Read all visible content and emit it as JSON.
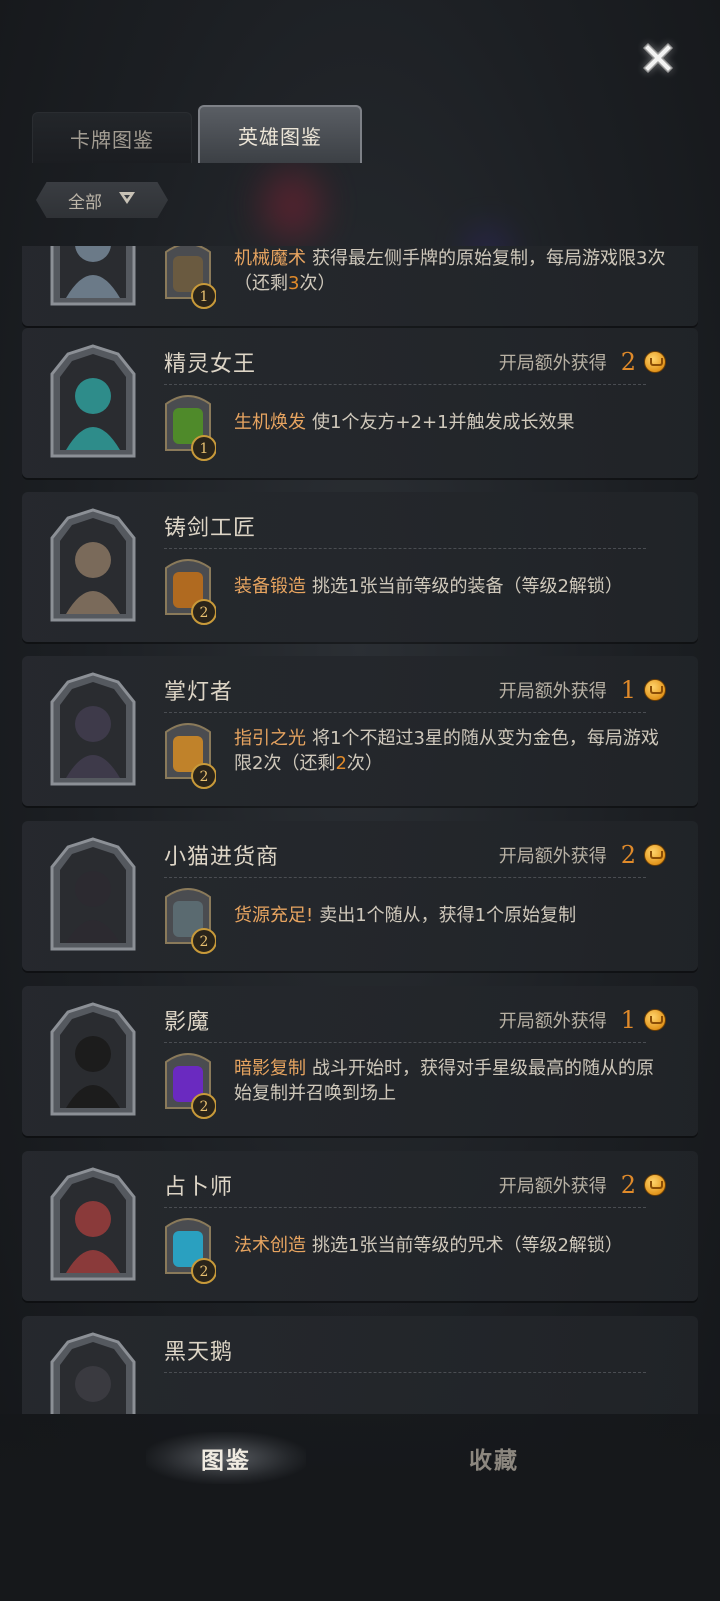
{
  "header": {
    "close_icon": "close-icon",
    "tabs": [
      {
        "label": "卡牌图鉴",
        "active": false
      },
      {
        "label": "英雄图鉴",
        "active": true
      }
    ],
    "filter": {
      "label": "全部",
      "icon": "dropdown-triangle-icon"
    }
  },
  "heroes": [
    {
      "name": "",
      "bonus_label": "",
      "bonus_value": "",
      "skill_level": "1",
      "skill_name": "机械魔术",
      "skill_desc_parts": [
        "获得最左侧手牌的原始复制，每局游戏限3次（还剩",
        "3",
        "次）"
      ]
    },
    {
      "name": "精灵女王",
      "bonus_label": "开局额外获得",
      "bonus_value": "2",
      "skill_level": "1",
      "skill_name": "生机焕发",
      "skill_desc_parts": [
        "使1个友方+2+1并触发成长效果",
        "",
        ""
      ]
    },
    {
      "name": "铸剑工匠",
      "bonus_label": "",
      "bonus_value": "",
      "skill_level": "2",
      "skill_name": "装备锻造",
      "skill_desc_parts": [
        "挑选1张当前等级的装备（等级2解锁）",
        "",
        ""
      ]
    },
    {
      "name": "掌灯者",
      "bonus_label": "开局额外获得",
      "bonus_value": "1",
      "skill_level": "2",
      "skill_name": "指引之光",
      "skill_desc_parts": [
        "将1个不超过3星的随从变为金色，每局游戏限2次（还剩",
        "2",
        "次）"
      ]
    },
    {
      "name": "小猫进货商",
      "bonus_label": "开局额外获得",
      "bonus_value": "2",
      "skill_level": "2",
      "skill_name": "货源充足!",
      "skill_desc_parts": [
        "卖出1个随从，获得1个原始复制",
        "",
        ""
      ]
    },
    {
      "name": "影魔",
      "bonus_label": "开局额外获得",
      "bonus_value": "1",
      "skill_level": "2",
      "skill_name": "暗影复制",
      "skill_desc_parts": [
        "战斗开始时，获得对手星级最高的随从的原始复制并召唤到场上",
        "",
        ""
      ]
    },
    {
      "name": "占卜师",
      "bonus_label": "开局额外获得",
      "bonus_value": "2",
      "skill_level": "2",
      "skill_name": "法术创造",
      "skill_desc_parts": [
        "挑选1张当前等级的咒术（等级2解锁）",
        "",
        ""
      ]
    },
    {
      "name": "黑天鹅",
      "bonus_label": "",
      "bonus_value": "",
      "skill_level": "",
      "skill_name": "",
      "skill_desc_parts": [
        "",
        "",
        ""
      ]
    }
  ],
  "bottom_nav": [
    {
      "label": "图鉴",
      "active": true
    },
    {
      "label": "收藏",
      "active": false
    }
  ],
  "colors": {
    "accent_orange": "#e08a2a",
    "skill_name": "#e7a460",
    "text": "#cfc8bb"
  }
}
